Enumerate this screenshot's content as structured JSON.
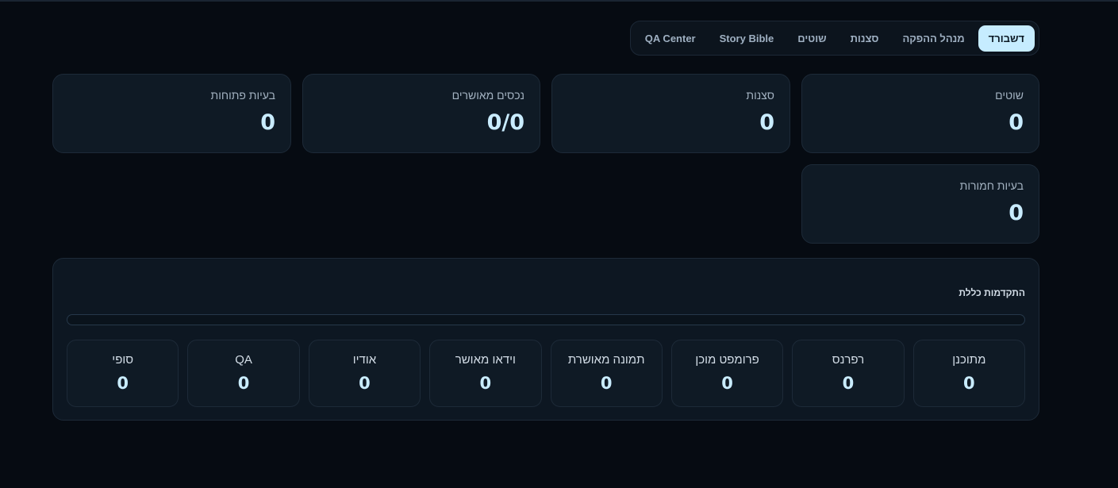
{
  "nav": {
    "tabs": [
      {
        "label": "דשבורד",
        "active": true
      },
      {
        "label": "מנהל ההפקה",
        "active": false
      },
      {
        "label": "סצנות",
        "active": false
      },
      {
        "label": "שוטים",
        "active": false
      },
      {
        "label": "Story Bible",
        "active": false
      },
      {
        "label": "QA Center",
        "active": false
      }
    ]
  },
  "stats": {
    "shots": {
      "label": "שוטים",
      "value": "0"
    },
    "scenes": {
      "label": "סצנות",
      "value": "0"
    },
    "approved_assets": {
      "label": "נכסים מאושרים",
      "value": "0/0"
    },
    "open_issues": {
      "label": "בעיות פתוחות",
      "value": "0"
    },
    "severe_issues": {
      "label": "בעיות חמורות",
      "value": "0"
    }
  },
  "progress": {
    "title": "התקדמות כללת",
    "fraction": 0,
    "stages": [
      {
        "label": "מתוכנן",
        "value": "0"
      },
      {
        "label": "רפרנס",
        "value": "0"
      },
      {
        "label": "פרומפט מוכן",
        "value": "0"
      },
      {
        "label": "תמונה מאושרת",
        "value": "0"
      },
      {
        "label": "וידאו מאושר",
        "value": "0"
      },
      {
        "label": "אודיו",
        "value": "0"
      },
      {
        "label": "QA",
        "value": "0"
      },
      {
        "label": "סופי",
        "value": "0"
      }
    ]
  },
  "colors": {
    "accent": "#c6ecff",
    "background": "#060b12",
    "card": "#0f1a25"
  }
}
